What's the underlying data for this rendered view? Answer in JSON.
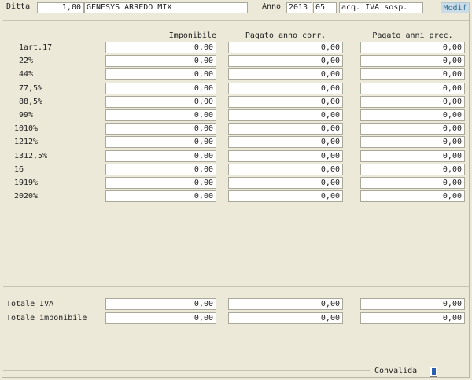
{
  "header": {
    "ditta_label": "Ditta",
    "ditta_code": "1,00",
    "ditta_name": "GENESYS ARREDO MIX",
    "anno_label": "Anno",
    "anno_value": "2013",
    "period_value": "05",
    "description": "acq. IVA sosp.",
    "modif_label": "Modif"
  },
  "columns": {
    "imponibile": "Imponibile",
    "pagato_corr": "Pagato anno corr.",
    "pagato_prec": "Pagato anni prec."
  },
  "rows": [
    {
      "code": "1",
      "desc": "art.17",
      "imponibile": "0,00",
      "pagato_corr": "0,00",
      "pagato_prec": "0,00"
    },
    {
      "code": "2",
      "desc": "2%",
      "imponibile": "0,00",
      "pagato_corr": "0,00",
      "pagato_prec": "0,00"
    },
    {
      "code": "4",
      "desc": "4%",
      "imponibile": "0,00",
      "pagato_corr": "0,00",
      "pagato_prec": "0,00"
    },
    {
      "code": "7",
      "desc": "7,5%",
      "imponibile": "0,00",
      "pagato_corr": "0,00",
      "pagato_prec": "0,00"
    },
    {
      "code": "8",
      "desc": "8,5%",
      "imponibile": "0,00",
      "pagato_corr": "0,00",
      "pagato_prec": "0,00"
    },
    {
      "code": "9",
      "desc": "9%",
      "imponibile": "0,00",
      "pagato_corr": "0,00",
      "pagato_prec": "0,00"
    },
    {
      "code": "10",
      "desc": "10%",
      "imponibile": "0,00",
      "pagato_corr": "0,00",
      "pagato_prec": "0,00"
    },
    {
      "code": "12",
      "desc": "12%",
      "imponibile": "0,00",
      "pagato_corr": "0,00",
      "pagato_prec": "0,00"
    },
    {
      "code": "13",
      "desc": "12,5%",
      "imponibile": "0,00",
      "pagato_corr": "0,00",
      "pagato_prec": "0,00"
    },
    {
      "code": "16",
      "desc": "",
      "imponibile": "0,00",
      "pagato_corr": "0,00",
      "pagato_prec": "0,00"
    },
    {
      "code": "19",
      "desc": "19%",
      "imponibile": "0,00",
      "pagato_corr": "0,00",
      "pagato_prec": "0,00"
    },
    {
      "code": "20",
      "desc": "20%",
      "imponibile": "0,00",
      "pagato_corr": "0,00",
      "pagato_prec": "0,00"
    }
  ],
  "totals": [
    {
      "label": "Totale IVA",
      "imponibile": "0,00",
      "pagato_corr": "0,00",
      "pagato_prec": "0,00"
    },
    {
      "label": "Totale imponibile",
      "imponibile": "0,00",
      "pagato_corr": "0,00",
      "pagato_prec": "0,00"
    }
  ],
  "footer": {
    "convalida_label": "Convalida"
  },
  "colors": {
    "background": "#ECE9D8",
    "field": "#FFFFFF",
    "modif_bg": "#C9DCE8",
    "modif_text": "#2D6F8E",
    "checkbox_fill": "#2A60B0"
  }
}
